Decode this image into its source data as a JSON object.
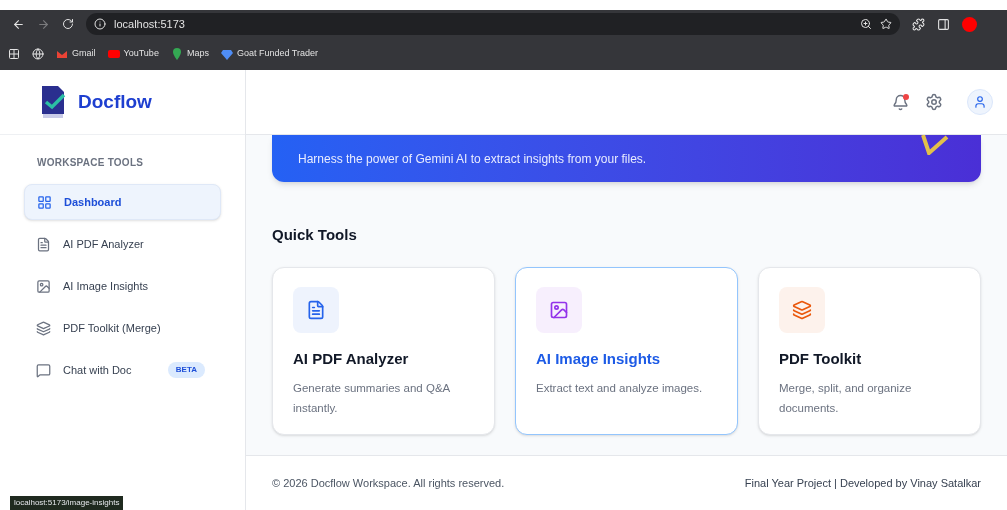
{
  "browser": {
    "url": "localhost:5173",
    "bookmarks": [
      {
        "label": "Gmail",
        "color": "#ea4335"
      },
      {
        "label": "YouTube",
        "color": "#ff0000"
      },
      {
        "label": "Maps",
        "color": "#34a853"
      },
      {
        "label": "Goat Funded Trader",
        "color": "#4f8df5"
      }
    ]
  },
  "brand": {
    "name": "Docflow"
  },
  "sidebar": {
    "section": "WORKSPACE TOOLS",
    "items": [
      {
        "label": "Dashboard",
        "selected": true
      },
      {
        "label": "AI PDF Analyzer",
        "selected": false
      },
      {
        "label": "AI Image Insights",
        "selected": false
      },
      {
        "label": "PDF Toolkit (Merge)",
        "selected": false
      },
      {
        "label": "Chat with Doc",
        "selected": false,
        "badge": "BETA"
      }
    ]
  },
  "header": {
    "notifications_unread": true
  },
  "banner": {
    "text": "Harness the power of Gemini AI to extract insights from your files."
  },
  "quick_tools": {
    "title": "Quick Tools",
    "cards": [
      {
        "title": "AI PDF Analyzer",
        "description": "Generate summaries and Q&A instantly.",
        "color": "#2563eb",
        "selected": false
      },
      {
        "title": "AI Image Insights",
        "description": "Extract text and analyze images.",
        "color": "#9333ea",
        "selected": true
      },
      {
        "title": "PDF Toolkit",
        "description": "Merge, split, and organize documents.",
        "color": "#ea580c",
        "selected": false
      }
    ]
  },
  "footer": {
    "copyright": "© 2026 Docflow Workspace. All rights reserved.",
    "credit": "Final Year Project | Developed by Vinay Satalkar"
  },
  "status_link": "localhost:5173/image-insights"
}
